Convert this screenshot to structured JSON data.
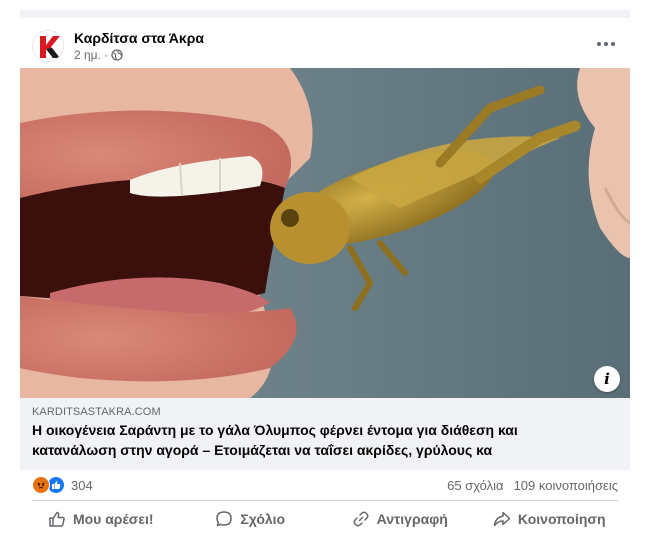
{
  "post": {
    "page_name": "Καρδίτσα στα Άκρα",
    "time": "2 ημ.",
    "separator": "·",
    "privacy_icon": "globe-icon",
    "more_icon": "more-options-icon"
  },
  "photo": {
    "info_label": "i"
  },
  "link": {
    "domain": "KARDITSASTAKRA.COM",
    "title_line1": "Η οικογένεια Σαράντη με το γάλα Όλυμπος φέρνει έντομα για διάθεση και",
    "title_line2": "κατανάλωση στην αγορά – Ετοιμάζεται να ταΐσει ακρίδες, γρύλους κα"
  },
  "stats": {
    "reaction_icons": [
      "angry-reaction-icon",
      "like-reaction-icon"
    ],
    "reactions_count": "304",
    "comments": "65 σχόλια",
    "shares": "109 κοινοποιήσεις"
  },
  "actions": {
    "like": "Μου αρέσει!",
    "comment": "Σχόλιο",
    "copy": "Αντιγραφή",
    "share": "Κοινοποίηση"
  },
  "colors": {
    "brand_red": "#d71a21",
    "secondary_text": "#65676b",
    "like_blue": "#1877f2",
    "angry_orange": "#e9710f",
    "preview_bg": "#f0f2f5"
  }
}
